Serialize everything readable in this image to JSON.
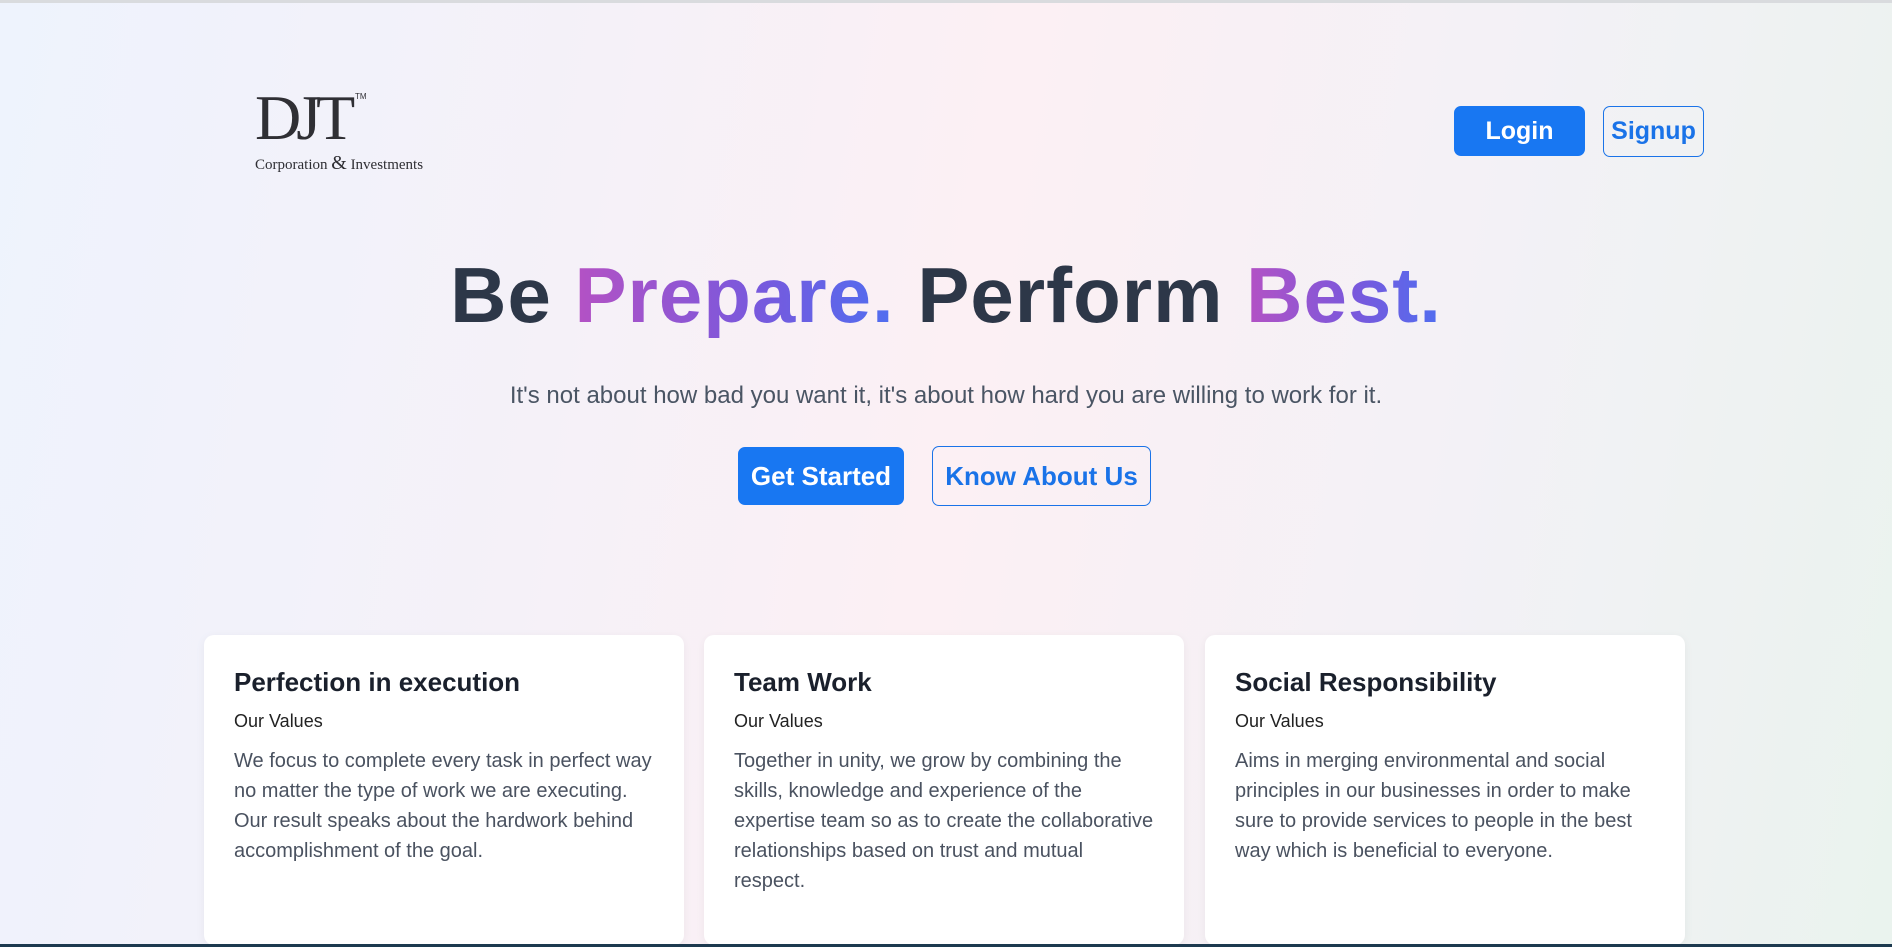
{
  "logo": {
    "mark": "DJT",
    "tm": "TM",
    "sub_left": "Corporation",
    "sub_amp": "&",
    "sub_right": "Investments"
  },
  "header": {
    "login_label": "Login",
    "signup_label": "Signup"
  },
  "hero": {
    "title_parts": [
      "Be",
      "Prepare.",
      "Perform",
      "Best."
    ],
    "subtitle": "It's not about how bad you want it, it's about how hard you are willing to work for it.",
    "get_started_label": "Get Started",
    "know_about_label": "Know About Us"
  },
  "cards": [
    {
      "title": "Perfection in execution",
      "subtitle": "Our Values",
      "text": "We focus to complete every task in perfect way no matter the type of work we are executing. Our result speaks about the hardwork behind accomplishment of the goal."
    },
    {
      "title": "Team Work",
      "subtitle": "Our Values",
      "text": "Together in unity, we grow by combining the skills, knowledge and experience of the expertise team so as to create the collaborative relationships based on trust and mutual respect."
    },
    {
      "title": "Social Responsibility",
      "subtitle": "Our Values",
      "text": "Aims in merging environmental and social principles in our businesses in order to make sure to provide services to people in the best way which is beneficial to everyone."
    }
  ],
  "colors": {
    "primary": "#1877f2",
    "heading": "#2d3748",
    "gradient_start": "#b452c4",
    "gradient_end": "#4f6ef0"
  }
}
